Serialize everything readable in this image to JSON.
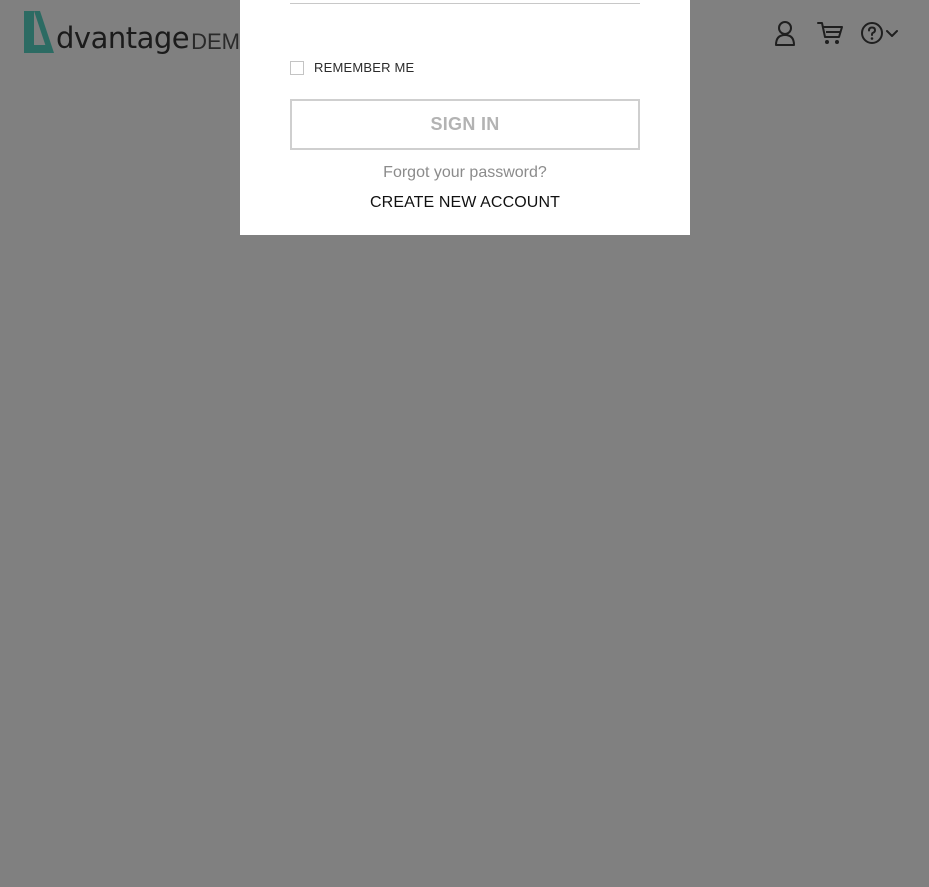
{
  "header": {
    "logo": {
      "word": "dvantage",
      "suffix": "DEMO",
      "mark_color": "#2c6b63"
    },
    "icons": {
      "user": "user-icon",
      "cart": "cart-icon",
      "help": "help-icon",
      "dropdown": "chevron-down-icon"
    }
  },
  "login_modal": {
    "remember_label": "REMEMBER ME",
    "remember_checked": false,
    "sign_in_label": "SIGN IN",
    "forgot_password": "Forgot your password?",
    "create_account": "CREATE NEW ACCOUNT"
  },
  "colors": {
    "overlay_background": "#808080",
    "sign_in_disabled_text": "#b3b3b3"
  }
}
